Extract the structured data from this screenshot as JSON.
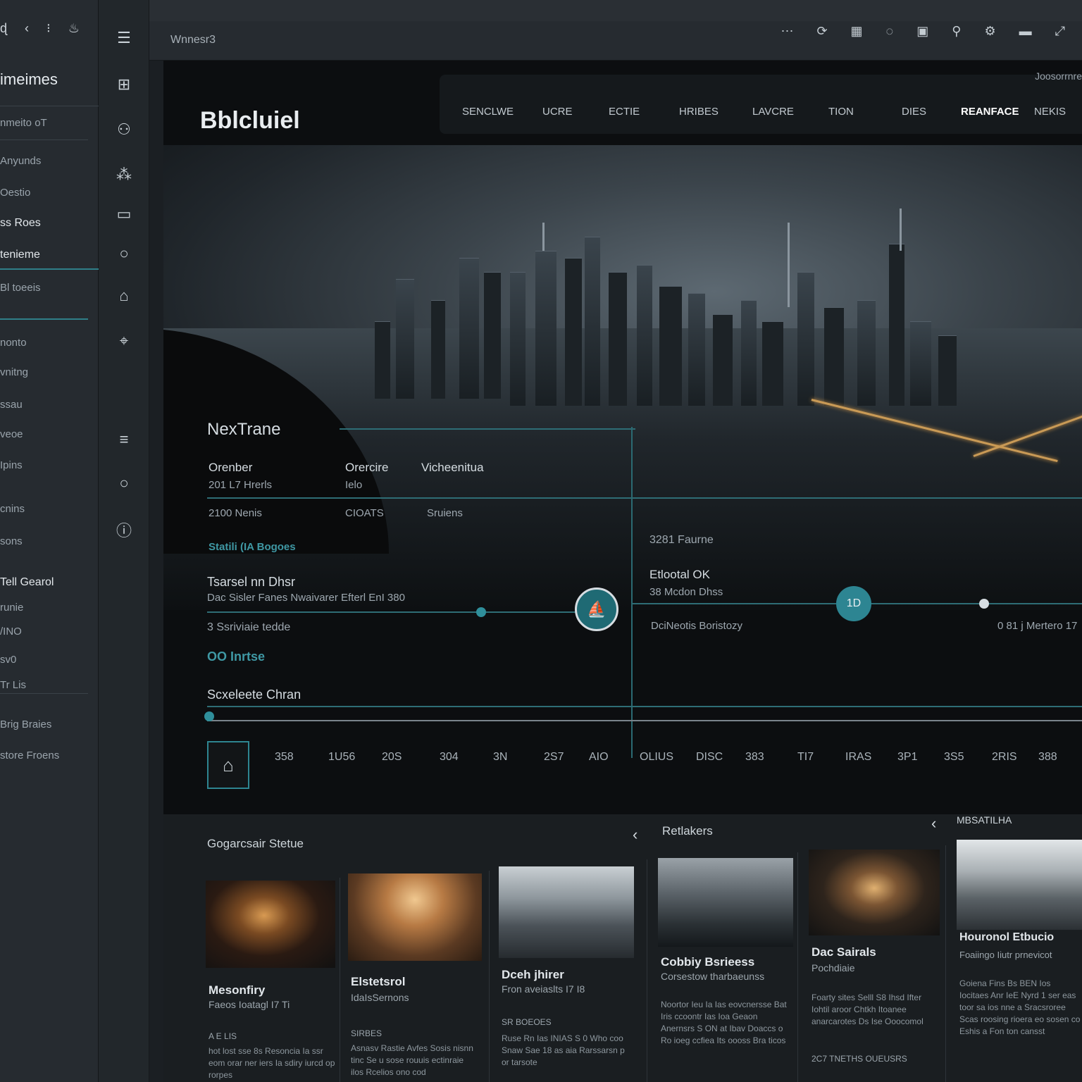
{
  "left_panel": {
    "top_icons": "ɖ ‹ ⁝ ♨",
    "title": "imeimes",
    "items": [
      "nmeito oT",
      "Anyunds",
      "Oestio",
      "ss Roes",
      "tenieme",
      "Bl toeeis",
      "nonto",
      "vnitng",
      "ssau",
      "veoe",
      "Ipins",
      "cnins",
      "sons",
      "Tell Gearol",
      "runie",
      "/INO",
      "sv0",
      "Tr Lis",
      "Brig Braies",
      "store Froens"
    ]
  },
  "topbar": {
    "title": "Wnnesr3",
    "icons": "⋯ ⟳ ▦ ◌ ▣ ⚲ ⚙ ▬ ⤢"
  },
  "hero": {
    "brand": "Bblcluiel",
    "nav": [
      "SENCLWE",
      "UCRE",
      "ECTIE",
      "HRIBES",
      "LAVCRE",
      "TION",
      "DIES",
      "REANFACE",
      "NEKIS"
    ],
    "nav_active": "REANFACE",
    "header_right": "Joosorrnre",
    "section_title": "NexTrane",
    "col1_label": "Orenber",
    "col1_value": "201 L7 Hrerls",
    "col2_label": "Orercire",
    "col2_value": "Ielo",
    "col3_label": "Vicheenitua",
    "row2_a": "2100 Nenis",
    "row2_b": "CIOATS",
    "row2_c": "Sruiens",
    "link": "Statili (IA Bogoes",
    "block_title": "Tsarsel nn Dhsr",
    "block_sub": "Dac Sisler Fanes Nwaivarer Efterl EnI 380",
    "block_line3": "3 Ssriviaie tedde",
    "status": "OO Inrtse",
    "right_a": "3281 Faurne",
    "right_b_title": "Etlootal OK",
    "right_b_sub": "38 Mcdon Dhss",
    "right_c": "DciNeotis Boristozy",
    "right_d": "0 81 j Mertero 17",
    "marker_main": "⛵",
    "marker_secondary": "1D",
    "timeline_title": "Scxeleete Chran",
    "ticks": [
      "358",
      "1U56",
      "20S",
      "304",
      "3N",
      "2S7",
      "AIO",
      "OLIUS",
      "DISC",
      "383",
      "TI7",
      "IRAS",
      "3P1",
      "3S5",
      "2RIS",
      "388"
    ]
  },
  "bottom": {
    "section_left": "Gogarcsair Stetue",
    "section_mid": "Retlakers",
    "section_right": "MBSATILHA",
    "cards": [
      {
        "title": "Mesonfiry",
        "sub": "Faeos Ioatagl I7 Ti",
        "meta": "A E LIS",
        "body": "hot lost sse 8s Resoncia Ia ssr eom orar ner iers Ia sdiry iurcd op rorpes"
      },
      {
        "title": "Elstetsrol",
        "sub": "IdaIsSernons",
        "meta": "SIRBES",
        "body": "Asnasv Rastie Avfes Sosis nisnn tinc Se u sose rouuis ectinraie ilos Rcelios ono cod"
      },
      {
        "title": "Dceh jhirer",
        "sub": "Fron aveiaslts I7 I8",
        "meta": "SR BOEOES",
        "body": "Ruse Rn Ias INIAS S 0 Who coo Snaw Sae 18 as aia Rarssarsn p or tarsote"
      },
      {
        "title": "Cobbiy Bsrieess",
        "sub": "Corsestow tharbaeunss",
        "meta": "",
        "body": "Noortor Ieu Ia Ias eovcnersse Bat Iris ccoontr Ias Ioa Geaon Anernsrs S ON at Ibav Doaccs o Ro ioeg ccfiea Its oooss Bra ticos"
      },
      {
        "title": "Dac Sairals",
        "sub": "Pochdiaie",
        "meta": "2C7 TNETHS OUEUSRS",
        "body": "Foarty sites Selll S8 Ihsd Ifter Iohtil aroor Chtkh Itoanee anarcarotes Ds Ise Ooocomol"
      },
      {
        "title": "Houronol Etbucio",
        "sub": "Foaiingo Iiutr prnevicot",
        "meta": "",
        "body": "Goiena Fins Bs BEN Ios Iocitaes Anr IeE Nyrd 1 ser eas toor sa ios nne a Sracsroree Scas roosing rioera eo sosen co Eshis a Fon ton cansst"
      }
    ]
  }
}
